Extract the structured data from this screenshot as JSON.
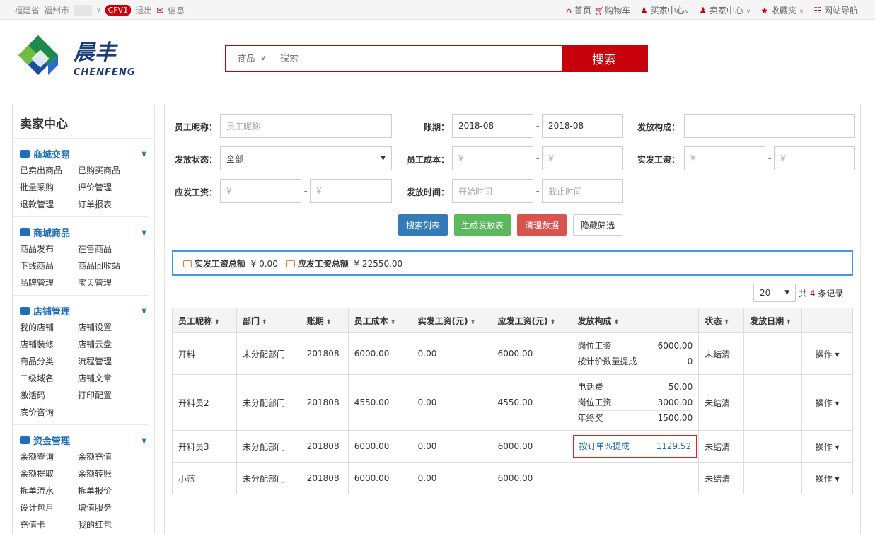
{
  "topbar": {
    "province": "福建省",
    "city": "福州市",
    "badge": "CFV1",
    "logout": "退出",
    "message": "信息",
    "home": "首页",
    "cart": "购物车",
    "buyer_center": "买家中心",
    "seller_center": "卖家中心",
    "favorites": "收藏夹",
    "site_nav": "网站导航"
  },
  "logo": {
    "cn": "晨丰",
    "en": "CHENFENG"
  },
  "search": {
    "category": "商品",
    "placeholder": "搜索",
    "button": "搜索"
  },
  "sidebar": {
    "title": "卖家中心",
    "sections": [
      {
        "title": "商城交易",
        "icon": "list-icon",
        "items": [
          "已卖出商品",
          "已购买商品",
          "批量采购",
          "评价管理",
          "退款管理",
          "订单报表"
        ]
      },
      {
        "title": "商城商品",
        "icon": "truck-icon",
        "items": [
          "商品发布",
          "在售商品",
          "下线商品",
          "商品回收站",
          "品牌管理",
          "宝贝管理"
        ]
      },
      {
        "title": "店铺管理",
        "icon": "home-icon",
        "items": [
          "我的店铺",
          "店铺设置",
          "店铺装修",
          "店铺云盘",
          "商品分类",
          "流程管理",
          "二级域名",
          "店铺文章",
          "激活码",
          "打印配置",
          "底价咨询"
        ]
      },
      {
        "title": "资金管理",
        "icon": "money-icon",
        "items": [
          "余额查询",
          "余额充值",
          "余额提取",
          "余额转账",
          "拆单流水",
          "拆单报价",
          "设计包月",
          "增值服务",
          "充值卡",
          "我的红包"
        ]
      }
    ]
  },
  "filters": {
    "nickname_label": "员工昵称：",
    "nickname_placeholder": "员工昵称",
    "period_label": "账期：",
    "period_from": "2018-08",
    "period_to": "2018-08",
    "composition_label": "发放构成：",
    "status_label": "发放状态：",
    "status_value": "全部",
    "cost_label": "员工成本：",
    "cost_from_ph": "¥",
    "cost_to_ph": "¥",
    "actual_label": "实发工资：",
    "actual_from_ph": "¥",
    "actual_to_ph": "¥",
    "due_label": "应发工资：",
    "due_from_ph": "¥",
    "due_to_ph": "¥",
    "time_label": "发放时间：",
    "time_from_ph": "开始时间",
    "time_to_ph": "截止时间",
    "dash": "-"
  },
  "buttons": {
    "search_list": "搜索列表",
    "generate": "生成发放表",
    "clear": "清理数据",
    "hide_filter": "隐藏筛选"
  },
  "summary": {
    "actual_total_label": "实发工资总额",
    "actual_total_value": "¥ 0.00",
    "due_total_label": "应发工资总额",
    "due_total_value": "¥ 22550.00"
  },
  "pagination": {
    "page_size": "20",
    "total_prefix": "共",
    "total_count": "4",
    "total_suffix": "条记录"
  },
  "table": {
    "headers": [
      "员工昵称",
      "部门",
      "账期",
      "员工成本",
      "实发工资(元)",
      "应发工资(元)",
      "发放构成",
      "状态",
      "发放日期"
    ],
    "rows": [
      {
        "name": "开料",
        "dept": "未分配部门",
        "period": "201808",
        "cost": "6000.00",
        "actual": "0.00",
        "due": "6000.00",
        "composition": [
          [
            "岗位工资",
            "6000.00"
          ],
          [
            "按计价数量提成",
            "0"
          ]
        ],
        "status": "未结清",
        "date": "",
        "op": "操作"
      },
      {
        "name": "开料员2",
        "dept": "未分配部门",
        "period": "201808",
        "cost": "4550.00",
        "actual": "0.00",
        "due": "4550.00",
        "composition": [
          [
            "电话费",
            "50.00"
          ],
          [
            "岗位工资",
            "3000.00"
          ],
          [
            "年终奖",
            "1500.00"
          ]
        ],
        "status": "未结清",
        "date": "",
        "op": "操作"
      },
      {
        "name": "开料员3",
        "dept": "未分配部门",
        "period": "201808",
        "cost": "6000.00",
        "actual": "0.00",
        "due": "6000.00",
        "composition": [
          [
            "按订单%提成",
            "1129.52"
          ]
        ],
        "status": "未结清",
        "date": "",
        "op": "操作"
      },
      {
        "name": "小蓝",
        "dept": "未分配部门",
        "period": "201808",
        "cost": "6000.00",
        "actual": "0.00",
        "due": "6000.00",
        "composition": [],
        "status": "未结清",
        "date": "",
        "op": "操作"
      }
    ]
  },
  "colors": {
    "brand_red": "#c7000b",
    "link_blue": "#1e6fb8",
    "highlight_border": "#e02020"
  }
}
